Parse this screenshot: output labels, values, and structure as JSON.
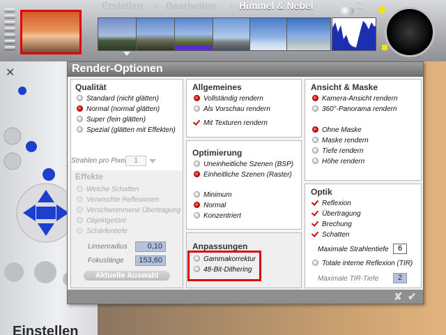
{
  "menu": {
    "items": [
      "Erstellen",
      "Bearbeiten",
      "Himmel & Nebel"
    ],
    "active_index": 2
  },
  "left_panel": {
    "label": "Einstellen"
  },
  "dialog": {
    "title": "Render-Optionen",
    "footer": {
      "cancel": "✘",
      "ok": "✔"
    },
    "qualitaet": {
      "title": "Qualität",
      "options": [
        {
          "label": "Standard (nicht glätten)",
          "selected": false
        },
        {
          "label": "Normal (normal glätten)",
          "selected": true
        },
        {
          "label": "Super (fein glätten)",
          "selected": false
        },
        {
          "label": "Spezial (glätten mit Effekten)",
          "selected": false
        }
      ],
      "strahlen_label": "Strahlen pro Pixel",
      "strahlen_value": "1"
    },
    "effekte": {
      "title": "Effekte",
      "options": [
        "Weiche Schatten",
        "Verwischte Reflexionen",
        "Verschwommene Übertragung",
        "Objektgetönt",
        "Schärfentiefe"
      ],
      "linsenradius_label": "Linsenradius",
      "linsenradius_value": "0,10",
      "fokuslaenge_label": "Fokuslänge",
      "fokuslaenge_value": "153,60",
      "aktuelle_button": "Aktuelle Auswahl"
    },
    "allgemeines": {
      "title": "Allgemeines",
      "options": [
        {
          "label": "Vollständig rendern",
          "selected": true
        },
        {
          "label": "Als Vorschau rendern",
          "selected": false
        }
      ],
      "texturen": {
        "label": "Mit Texturen rendern",
        "checked": true
      }
    },
    "optimierung": {
      "title": "Optimierung",
      "options": [
        {
          "label": "Uneinheitliche Szenen (BSP)",
          "selected": false
        },
        {
          "label": "Einheitliche Szenen (Raster)",
          "selected": true
        }
      ],
      "level_options": [
        {
          "label": "Minimum",
          "selected": false
        },
        {
          "label": "Normal",
          "selected": true
        },
        {
          "label": "Konzentriert",
          "selected": false
        }
      ]
    },
    "anpassungen": {
      "title": "Anpassungen",
      "options": [
        "Gammakorrektur",
        "48-Bit-Dithering"
      ]
    },
    "ansicht": {
      "title": "Ansicht & Maske",
      "options": [
        {
          "label": "Kamera-Ansicht rendern",
          "selected": true
        },
        {
          "label": "360°-Panorama rendern",
          "selected": false
        }
      ],
      "mask_options": [
        {
          "label": "Ohne Maske",
          "selected": true
        },
        {
          "label": "Maske rendern",
          "selected": false
        },
        {
          "label": "Tiefe rendern",
          "selected": false
        },
        {
          "label": "Höhe rendern",
          "selected": false
        }
      ]
    },
    "optik": {
      "title": "Optik",
      "checks": [
        "Reflexion",
        "Übertragung",
        "Brechung",
        "Schatten"
      ],
      "max_strahlentiefe_label": "Maximale Strahlentiefe",
      "max_strahlentiefe_value": "6",
      "tir_label": "Totale interne Reflexion (TIR)",
      "tir_tiefe_label": "Maximale TIR-Tiefe",
      "tir_tiefe_value": "2"
    }
  },
  "colors": {
    "highlight": "#e00000",
    "selected_radio": "#c80000",
    "field_bg": "#b6c3d6"
  }
}
